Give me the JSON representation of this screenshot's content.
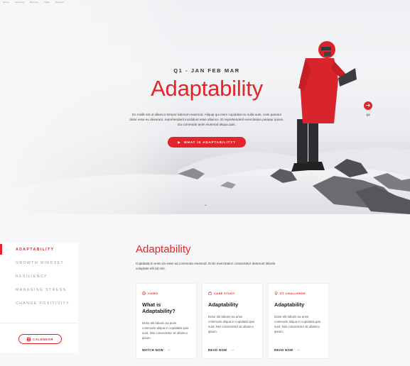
{
  "topnav": [
    "Home",
    "Learning",
    "Reports",
    "Tools",
    "Support"
  ],
  "hero": {
    "eyebrow": "Q1 - JAN FEB MAR",
    "title": "Adaptability",
    "description": "Do mollit est ut ullamco tempor laborum eiusmod. Aliquip qui enim cupidatat eu nulla aute. Aute pariatur dolor esse eu deserunt. reprehenderit incididunt esse ullamco. Et reprehenderit exercitation pariatur ipsum. Ea commodo anim eiusmod aliqua quis.",
    "button_label": "WHAT IS ADAPTABILITY?",
    "next_label": "Q2",
    "colors": {
      "accent": "#e1252a"
    }
  },
  "sidebar": {
    "items": [
      {
        "label": "ADAPTABILITY",
        "active": true
      },
      {
        "label": "GROWTH MINDSET",
        "active": false
      },
      {
        "label": "RESILIENCY",
        "active": false
      },
      {
        "label": "MANAGING STRESS",
        "active": false
      },
      {
        "label": "CHANGE POSITIVITY",
        "active": false
      }
    ],
    "calendar_label": "CALENDAR"
  },
  "main": {
    "title": "Adaptability",
    "description": "Cupidatat in enim do esse ad commodo eiusmod. Enim exercitation consectetur deserunt laboris voluptate elit ad sint.",
    "cards": [
      {
        "tag": "VIDEO",
        "icon": "play-circle-icon",
        "title": "What is Adaptability?",
        "body": "Dolor elit laboris ea anim commodo aliqua in cupidatat quis sunt. Nisi consectetur sit ullamco ipsum.",
        "link": "WATCH NOW"
      },
      {
        "tag": "CASE STUDY",
        "icon": "briefcase-icon",
        "title": "Adaptability",
        "body": "Dolor elit laboris ea anim commodo aliqua in cupidatat quis sunt. Nisi consectetur sit ullamco ipsum.",
        "link": "READ NOW"
      },
      {
        "tag": "CT CHALLENGE",
        "icon": "lightbulb-icon",
        "title": "Adaptability",
        "body": "Dolor elit laboris ea anim commodo aliqua in cupidatat quis sunt. Nisi consectetur sit ullamco ipsum.",
        "link": "READ NOW"
      }
    ]
  }
}
